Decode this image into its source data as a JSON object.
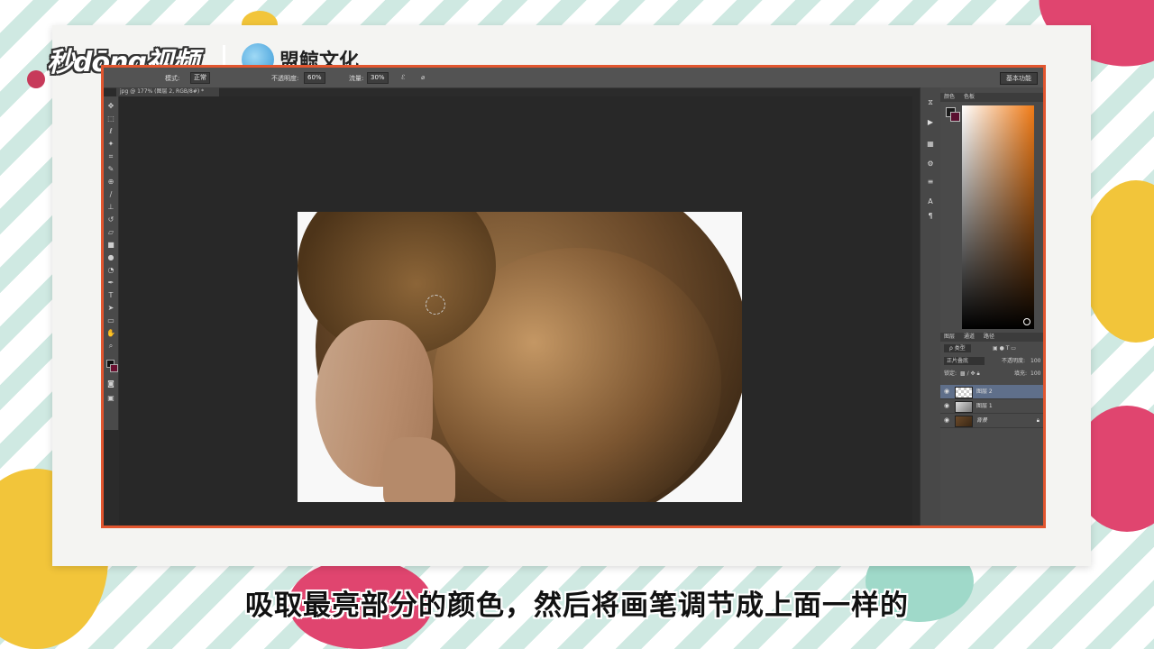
{
  "brand": {
    "logo_text": "秒dōng视频",
    "partner_name": "盟鲸文化"
  },
  "photoshop": {
    "options_bar": {
      "mode_label": "模式:",
      "mode_value": "正常",
      "opacity_label": "不透明度:",
      "opacity_value": "60%",
      "flow_label": "流量:",
      "flow_value": "30%"
    },
    "workspace_button": "基本功能",
    "document_tab": "jpg @ 177% (图层 2, RGB/8#) *",
    "color_panel": {
      "tabs": [
        "颜色",
        "色板"
      ],
      "foreground_color": "#1a1a1a",
      "background_color": "#5a1030",
      "hue_color": "#f07b17"
    },
    "layers_panel": {
      "tabs": [
        "图层",
        "通道",
        "路径"
      ],
      "filter_label": "ρ 类型",
      "blend_mode": "正片叠底",
      "opacity_label": "不透明度:",
      "opacity_value": "100",
      "lock_label": "锁定:",
      "fill_label": "填充:",
      "fill_value": "100",
      "layers": [
        {
          "name": "图层 2",
          "active": true
        },
        {
          "name": "图层 1",
          "active": false
        },
        {
          "name": "背景",
          "active": false
        }
      ]
    }
  },
  "caption": "吸取最亮部分的颜色，然后将画笔调节成上面一样的"
}
